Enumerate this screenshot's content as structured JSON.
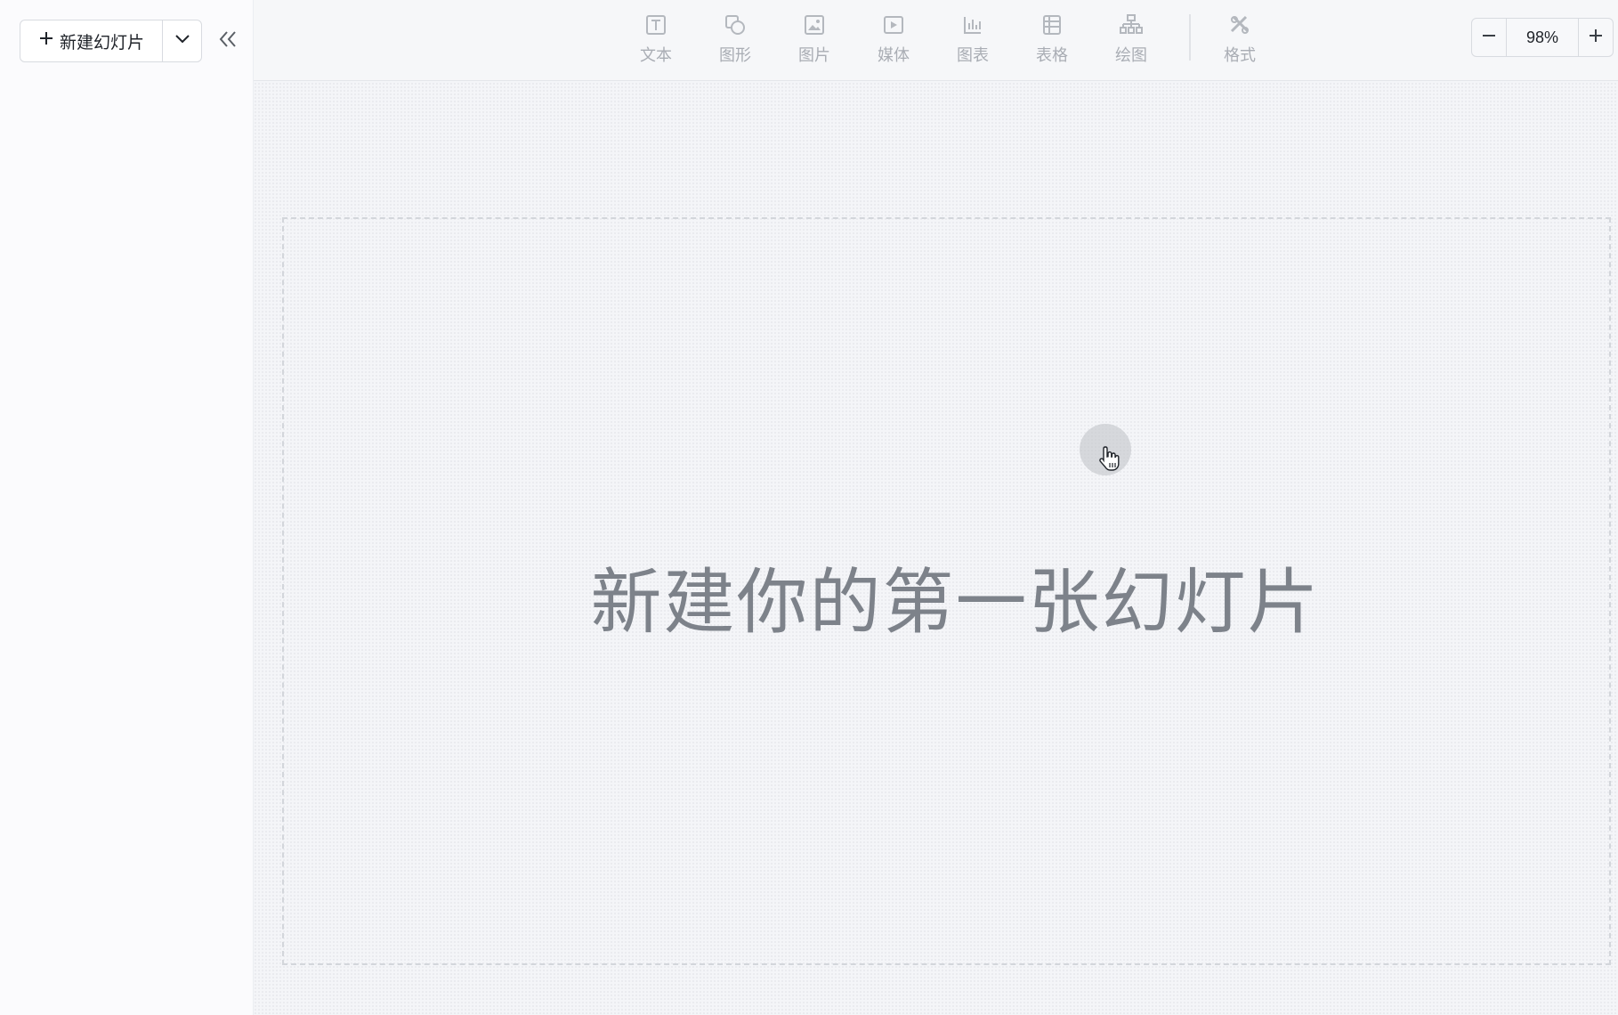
{
  "sidebar": {
    "new_slide_label": "新建幻灯片",
    "new_slide_icon": "plus-icon",
    "dropdown_icon": "chevron-down-icon",
    "collapse_icon": "double-chevron-left-icon"
  },
  "toolbar": {
    "tools": [
      {
        "label": "文本",
        "icon": "text-icon"
      },
      {
        "label": "图形",
        "icon": "shape-icon"
      },
      {
        "label": "图片",
        "icon": "image-icon"
      },
      {
        "label": "媒体",
        "icon": "media-icon"
      },
      {
        "label": "图表",
        "icon": "chart-icon"
      },
      {
        "label": "表格",
        "icon": "table-icon"
      },
      {
        "label": "绘图",
        "icon": "diagram-icon"
      },
      {
        "label": "格式",
        "icon": "format-icon"
      }
    ],
    "zoom": {
      "value": "98%",
      "zoom_out_icon": "minus-icon",
      "zoom_in_icon": "plus-icon"
    }
  },
  "canvas": {
    "placeholder_text": "新建你的第一张幻灯片",
    "cursor_icon": "hand-pointer-icon"
  },
  "colors": {
    "icon_gray": "#b4b8be",
    "label_gray": "#a9adb4",
    "placeholder_text": "#7d828a"
  }
}
